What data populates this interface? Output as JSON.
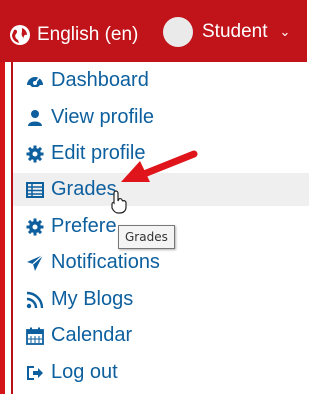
{
  "navbar": {
    "language_label": "English (en)",
    "user_label": "Student",
    "caret_icon": "chevron-down-icon",
    "background_color": "#c0131a"
  },
  "menu": {
    "items": [
      {
        "label": "Dashboard",
        "icon": "dashboard-icon"
      },
      {
        "label": "View profile",
        "icon": "user-icon"
      },
      {
        "label": "Edit profile",
        "icon": "gear-icon"
      },
      {
        "label": "Grades",
        "icon": "table-icon"
      },
      {
        "label": "Prefere",
        "icon": "wrench-icon"
      },
      {
        "label": "Notifications",
        "icon": "paper-plane-icon"
      },
      {
        "label": "My Blogs",
        "icon": "rss-icon"
      },
      {
        "label": "Calendar",
        "icon": "calendar-icon"
      },
      {
        "label": "Log out",
        "icon": "sign-out-icon"
      }
    ],
    "hovered_item": "Grades",
    "link_color": "#0d5f9e"
  },
  "tooltip": {
    "text": "Grades"
  },
  "annotation": {
    "arrow_color": "#e0141b"
  }
}
